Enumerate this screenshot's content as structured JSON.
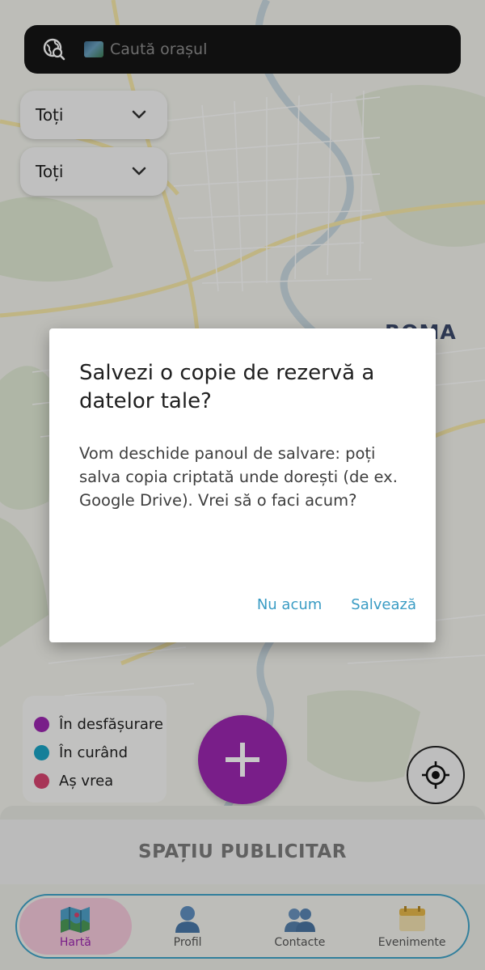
{
  "search": {
    "placeholder": "Caută orașul"
  },
  "filters": {
    "status": "Toți",
    "category": "Toți"
  },
  "map": {
    "city_label": "ROMA"
  },
  "legend": [
    {
      "label": "În desfășurare",
      "color": "#9c27b0"
    },
    {
      "label": "În curând",
      "color": "#1aa3c4"
    },
    {
      "label": "Aș vrea",
      "color": "#d64570"
    }
  ],
  "ad": {
    "label": "SPAȚIU PUBLICITAR"
  },
  "nav": {
    "items": [
      {
        "label": "Hartă",
        "icon": "map-icon",
        "active": true
      },
      {
        "label": "Profil",
        "icon": "person-icon",
        "active": false
      },
      {
        "label": "Contacte",
        "icon": "people-icon",
        "active": false
      },
      {
        "label": "Evenimente",
        "icon": "calendar-icon",
        "active": false
      }
    ]
  },
  "dialog": {
    "title": "Salvezi o copie de rezervă a datelor tale?",
    "message": "Vom deschide panoul de salvare: poți salva copia criptată unde dorești (de ex. Google Drive). Vrei să o faci acum?",
    "cancel_label": "Nu acum",
    "confirm_label": "Salvează"
  },
  "colors": {
    "accent": "#9c27b0",
    "link": "#3a9cc4",
    "nav_border": "#3fa3c8"
  }
}
